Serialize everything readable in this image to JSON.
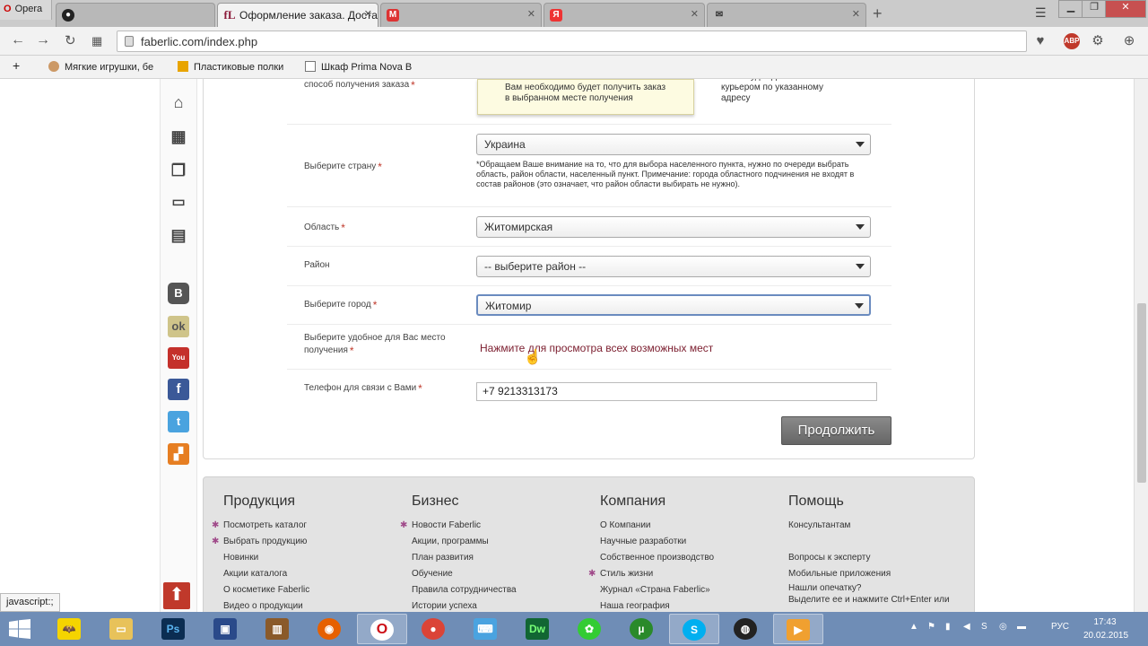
{
  "browser": {
    "menu_label": "Opera",
    "tabs": [
      {
        "title": "",
        "active": false
      },
      {
        "title": "Оформление заказа. Доставка",
        "active": true
      },
      {
        "title": "",
        "active": false
      },
      {
        "title": "",
        "active": false
      },
      {
        "title": "",
        "active": false
      }
    ],
    "url": "faberlic.com/index.php",
    "bookmarks": [
      "Мягкие игрушки, бе",
      "Пластиковые полки",
      "Шкаф Prima Nova B"
    ]
  },
  "form": {
    "pickup_label": "способ получения заказа",
    "pickup_hint": "Вам необходимо будет получить заказ в выбранном месте получения",
    "courier_text": "заказ будет доставлен курьером по указанному адресу",
    "country_label": "Выберите страну",
    "country_value": "Украина",
    "country_note": "*Обращаем Ваше внимание на то, что для выбора населенного пункта, нужно по очереди выбрать область, район области, населенный пункт. Примечание: города областного подчинения не входят в состав районов (это означает, что район области выбирать не нужно).",
    "region_label": "Область",
    "region_value": "Житомирская",
    "district_label": "Район",
    "district_value": "-- выберите район --",
    "city_label": "Выберите город",
    "city_value": "Житомир",
    "place_label": "Выберите удобное для Вас место получения",
    "place_link": "Нажмите для просмотра всех возможных мест",
    "phone_label": "Телефон для связи с Вами",
    "phone_value": "+7 9213313173",
    "required_mark": "*",
    "continue_button": "Продолжить"
  },
  "footer": {
    "products": {
      "title": "Продукция",
      "items": [
        "Посмотреть каталог",
        "Выбрать продукцию",
        "Новинки",
        "Акции каталога",
        "О косметике Faberlic",
        "Видео о продукции"
      ]
    },
    "business": {
      "title": "Бизнес",
      "items": [
        "Новости Faberlic",
        "Акции, программы",
        "План развития",
        "Обучение",
        "Правила сотрудничества",
        "Истории успеха"
      ]
    },
    "company": {
      "title": "Компания",
      "items": [
        "О Компании",
        "Научные разработки",
        "Собственное производство",
        "Стиль жизни",
        "Журнал «Страна Faberlic»",
        "Наша география"
      ]
    },
    "help": {
      "title": "Помощь",
      "items": [
        "Консультантам",
        "Вопросы к эксперту",
        "Мобильные приложения",
        "Нашли опечатку?",
        "Выделите ее и нажмите Ctrl+Enter или"
      ]
    }
  },
  "status_bar": "javascript:;",
  "taskbar": {
    "lang": "РУС",
    "time": "17:43",
    "date": "20.02.2015"
  }
}
